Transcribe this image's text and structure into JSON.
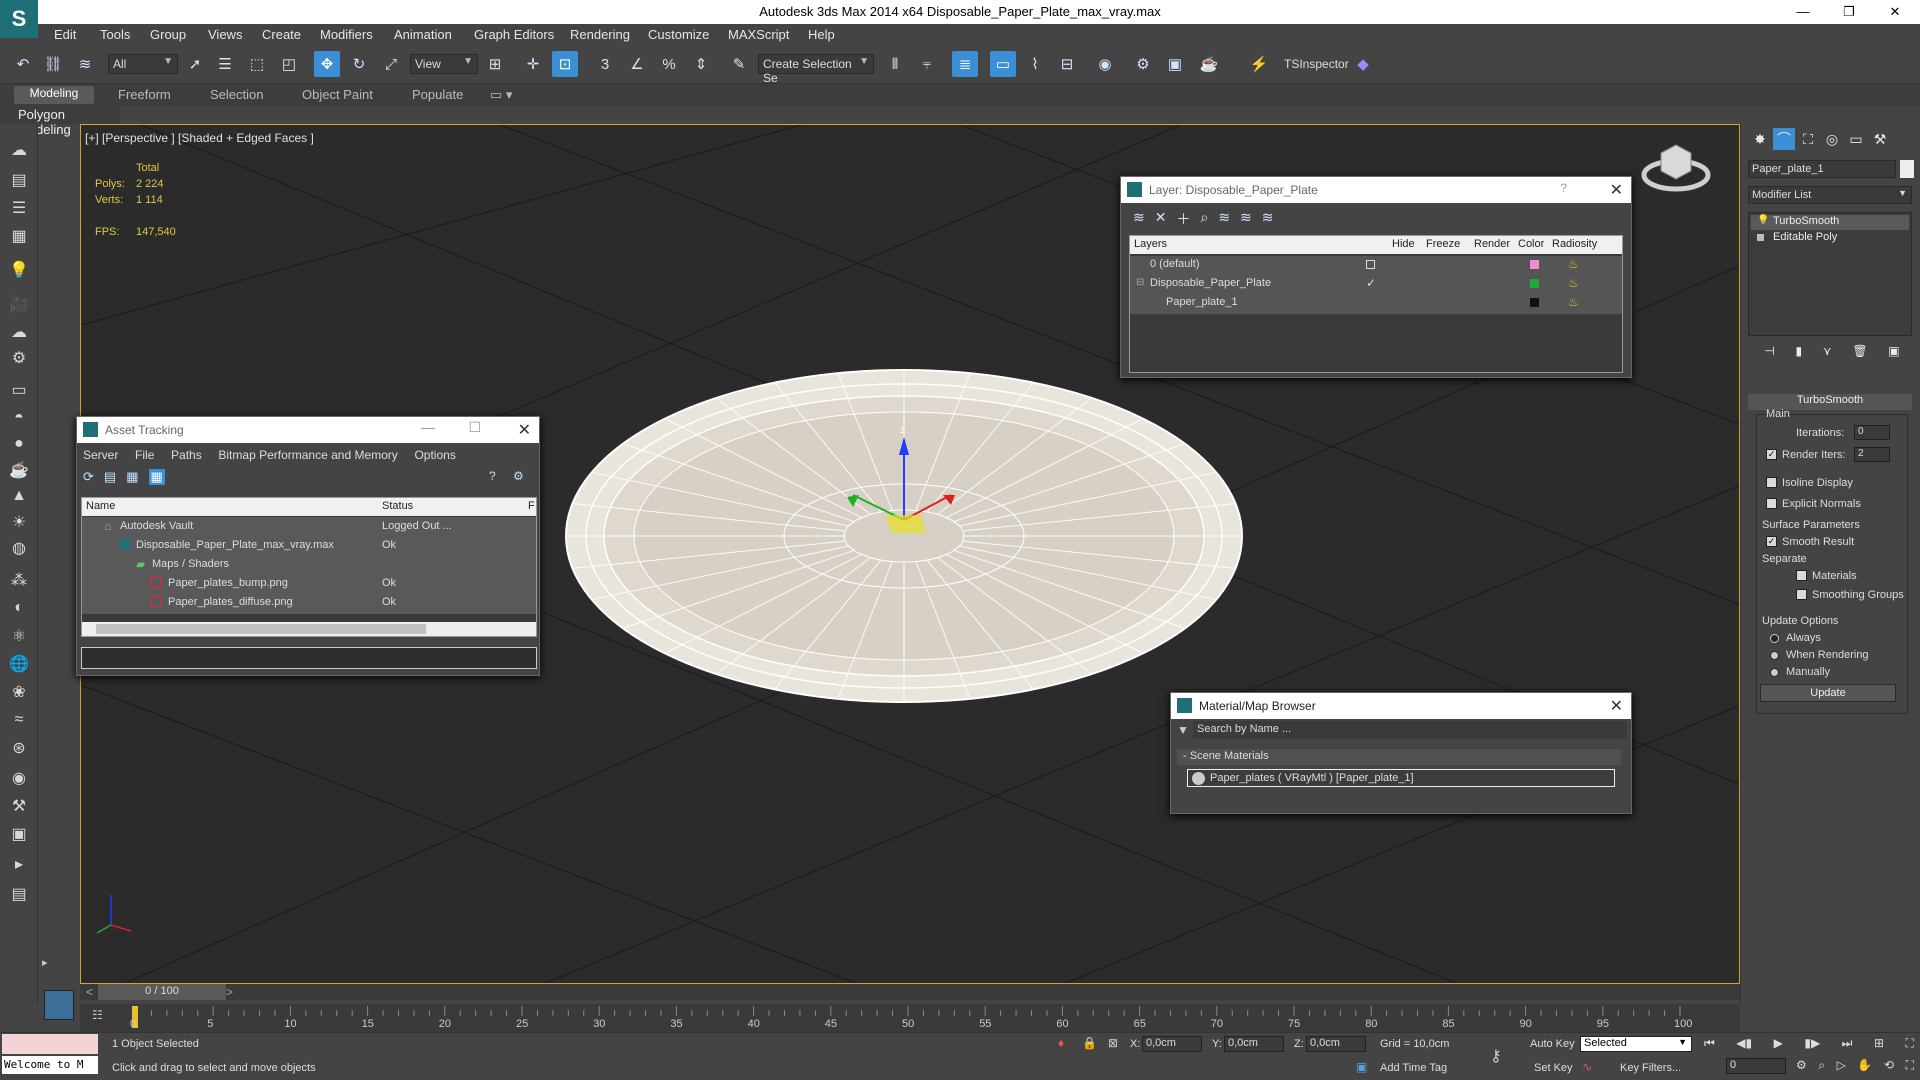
{
  "window": {
    "title": "Autodesk 3ds Max  2014 x64    Disposable_Paper_Plate_max_vray.max"
  },
  "menu": [
    "Edit",
    "Tools",
    "Group",
    "Views",
    "Create",
    "Modifiers",
    "Animation",
    "Graph Editors",
    "Rendering",
    "Customize",
    "MAXScript",
    "Help"
  ],
  "toolbar": {
    "selection_filter": "All",
    "ref_coord": "View",
    "selection_set_placeholder": "Create Selection Se",
    "tsinspector_label": "TSInspector"
  },
  "ribbon": {
    "tabs": [
      "Modeling",
      "Freeform",
      "Selection",
      "Object Paint",
      "Populate"
    ],
    "panel_label": "Polygon Modeling"
  },
  "viewport": {
    "label": "[+] [Perspective ] [Shaded + Edged Faces ]",
    "stats": {
      "total_label": "Total",
      "polys_label": "Polys:",
      "polys_value": "2 224",
      "verts_label": "Verts:",
      "verts_value": "1 114",
      "fps_label": "FPS:",
      "fps_value": "147,540"
    },
    "gizmo_z": "z"
  },
  "layer_window": {
    "title": "Layer: Disposable_Paper_Plate",
    "help": "?",
    "columns": [
      "Layers",
      "Hide",
      "Freeze",
      "Render",
      "Color",
      "Radiosity"
    ],
    "rows": [
      {
        "name": "0 (default)",
        "color": "#f08cd0"
      },
      {
        "name": "Disposable_Paper_Plate",
        "color": "#1faa35"
      },
      {
        "name": "Paper_plate_1",
        "color": "#111111"
      }
    ]
  },
  "asset_window": {
    "title": "Asset Tracking",
    "menu": [
      "Server",
      "File",
      "Paths",
      "Bitmap Performance and Memory",
      "Options"
    ],
    "col_name": "Name",
    "col_status": "Status",
    "col_extra": "F",
    "rows": [
      {
        "name": "Autodesk Vault",
        "status": "Logged Out ..."
      },
      {
        "name": "Disposable_Paper_Plate_max_vray.max",
        "status": "Ok"
      },
      {
        "name": "Maps / Shaders",
        "status": ""
      },
      {
        "name": "Paper_plates_bump.png",
        "status": "Ok"
      },
      {
        "name": "Paper_plates_diffuse.png",
        "status": "Ok"
      }
    ]
  },
  "material_window": {
    "title": "Material/Map Browser",
    "search_placeholder": "Search by Name ...",
    "section": "Scene Materials",
    "item": "Paper_plates  ( VRayMtl )  [Paper_plate_1]"
  },
  "command_panel": {
    "object_name": "Paper_plate_1",
    "modifier_list": "Modifier List",
    "stack": [
      "TurboSmooth",
      "Editable Poly"
    ],
    "rollout_title": "TurboSmooth",
    "main_label": "Main",
    "iterations_label": "Iterations:",
    "iterations_value": "0",
    "render_iters_label": "Render Iters:",
    "render_iters_value": "2",
    "isoline_label": "Isoline Display",
    "explicit_normals_label": "Explicit Normals",
    "surface_params_label": "Surface Parameters",
    "smooth_result_label": "Smooth Result",
    "separate_label": "Separate",
    "materials_label": "Materials",
    "smoothing_groups_label": "Smoothing Groups",
    "update_options_label": "Update Options",
    "always_label": "Always",
    "when_rendering_label": "When Rendering",
    "manually_label": "Manually",
    "update_button": "Update"
  },
  "timeline": {
    "frame": "0 / 100",
    "ticks": [
      "0",
      "5",
      "10",
      "15",
      "20",
      "25",
      "30",
      "35",
      "40",
      "45",
      "50",
      "55",
      "60",
      "65",
      "70",
      "75",
      "80",
      "85",
      "90",
      "95",
      "100"
    ]
  },
  "status": {
    "maxscript_field": "Welcome to M",
    "selection": "1 Object Selected",
    "prompt": "Click and drag to select and move objects",
    "x_label": "X:",
    "x_value": "0,0cm",
    "y_label": "Y:",
    "y_value": "0,0cm",
    "z_label": "Z:",
    "z_value": "0,0cm",
    "grid": "Grid = 10,0cm",
    "add_time_tag": "Add Time Tag",
    "auto_key": "Auto Key",
    "set_key": "Set Key",
    "selected_dropdown": "Selected",
    "key_filters": "Key Filters...",
    "current_frame": "0"
  }
}
